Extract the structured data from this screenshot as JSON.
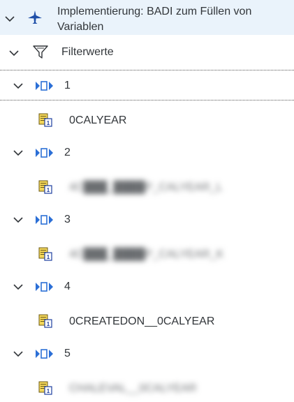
{
  "root": {
    "label": "Implementierung: BADI zum Füllen von Variablen",
    "icon": "plane-icon"
  },
  "filter": {
    "label": "Filterwerte",
    "icon": "funnel-icon"
  },
  "groups": [
    {
      "label": "1",
      "child": "0CALYEAR",
      "child_redacted": false
    },
    {
      "label": "2",
      "child": "4C███_████P_CALYEAR_L",
      "child_redacted": true
    },
    {
      "label": "3",
      "child": "4C███_████P_CALYEAR_K",
      "child_redacted": true
    },
    {
      "label": "4",
      "child": "0CREATEDON__0CALYEAR",
      "child_redacted": false
    },
    {
      "label": "5",
      "child": "CHALEVAL__0CALYEAR",
      "child_redacted": true
    }
  ],
  "colors": {
    "header_bg": "#eaf3fb",
    "text": "#32363a",
    "chevron": "#32363a",
    "node_blue": "#0a6ed1",
    "doc_yellow": "#e9c73a"
  }
}
